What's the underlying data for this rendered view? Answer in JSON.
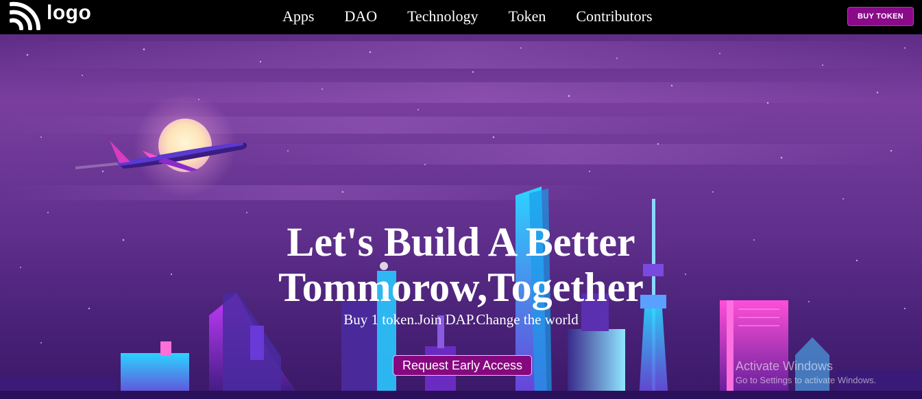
{
  "brand": {
    "logo_text": "logo",
    "logo_icon": "rss-icon"
  },
  "nav": {
    "items": [
      {
        "label": "Apps"
      },
      {
        "label": "DAO"
      },
      {
        "label": "Technology"
      },
      {
        "label": "Token"
      },
      {
        "label": "Contributors"
      }
    ],
    "buy_button": "BUY TOKEN"
  },
  "hero": {
    "title_line1": "Let's Build A Better",
    "title_line2": "Tommorow,Together",
    "subtitle": "Buy 1 token.Join DAP.Change the world",
    "cta_label": "Request Early Access"
  },
  "watermark": {
    "title": "Activate Windows",
    "subtitle": "Go to Settings to activate Windows."
  },
  "colors": {
    "accent": "#8a0a8a",
    "navbar": "#000000",
    "sky": "#6d3796"
  }
}
